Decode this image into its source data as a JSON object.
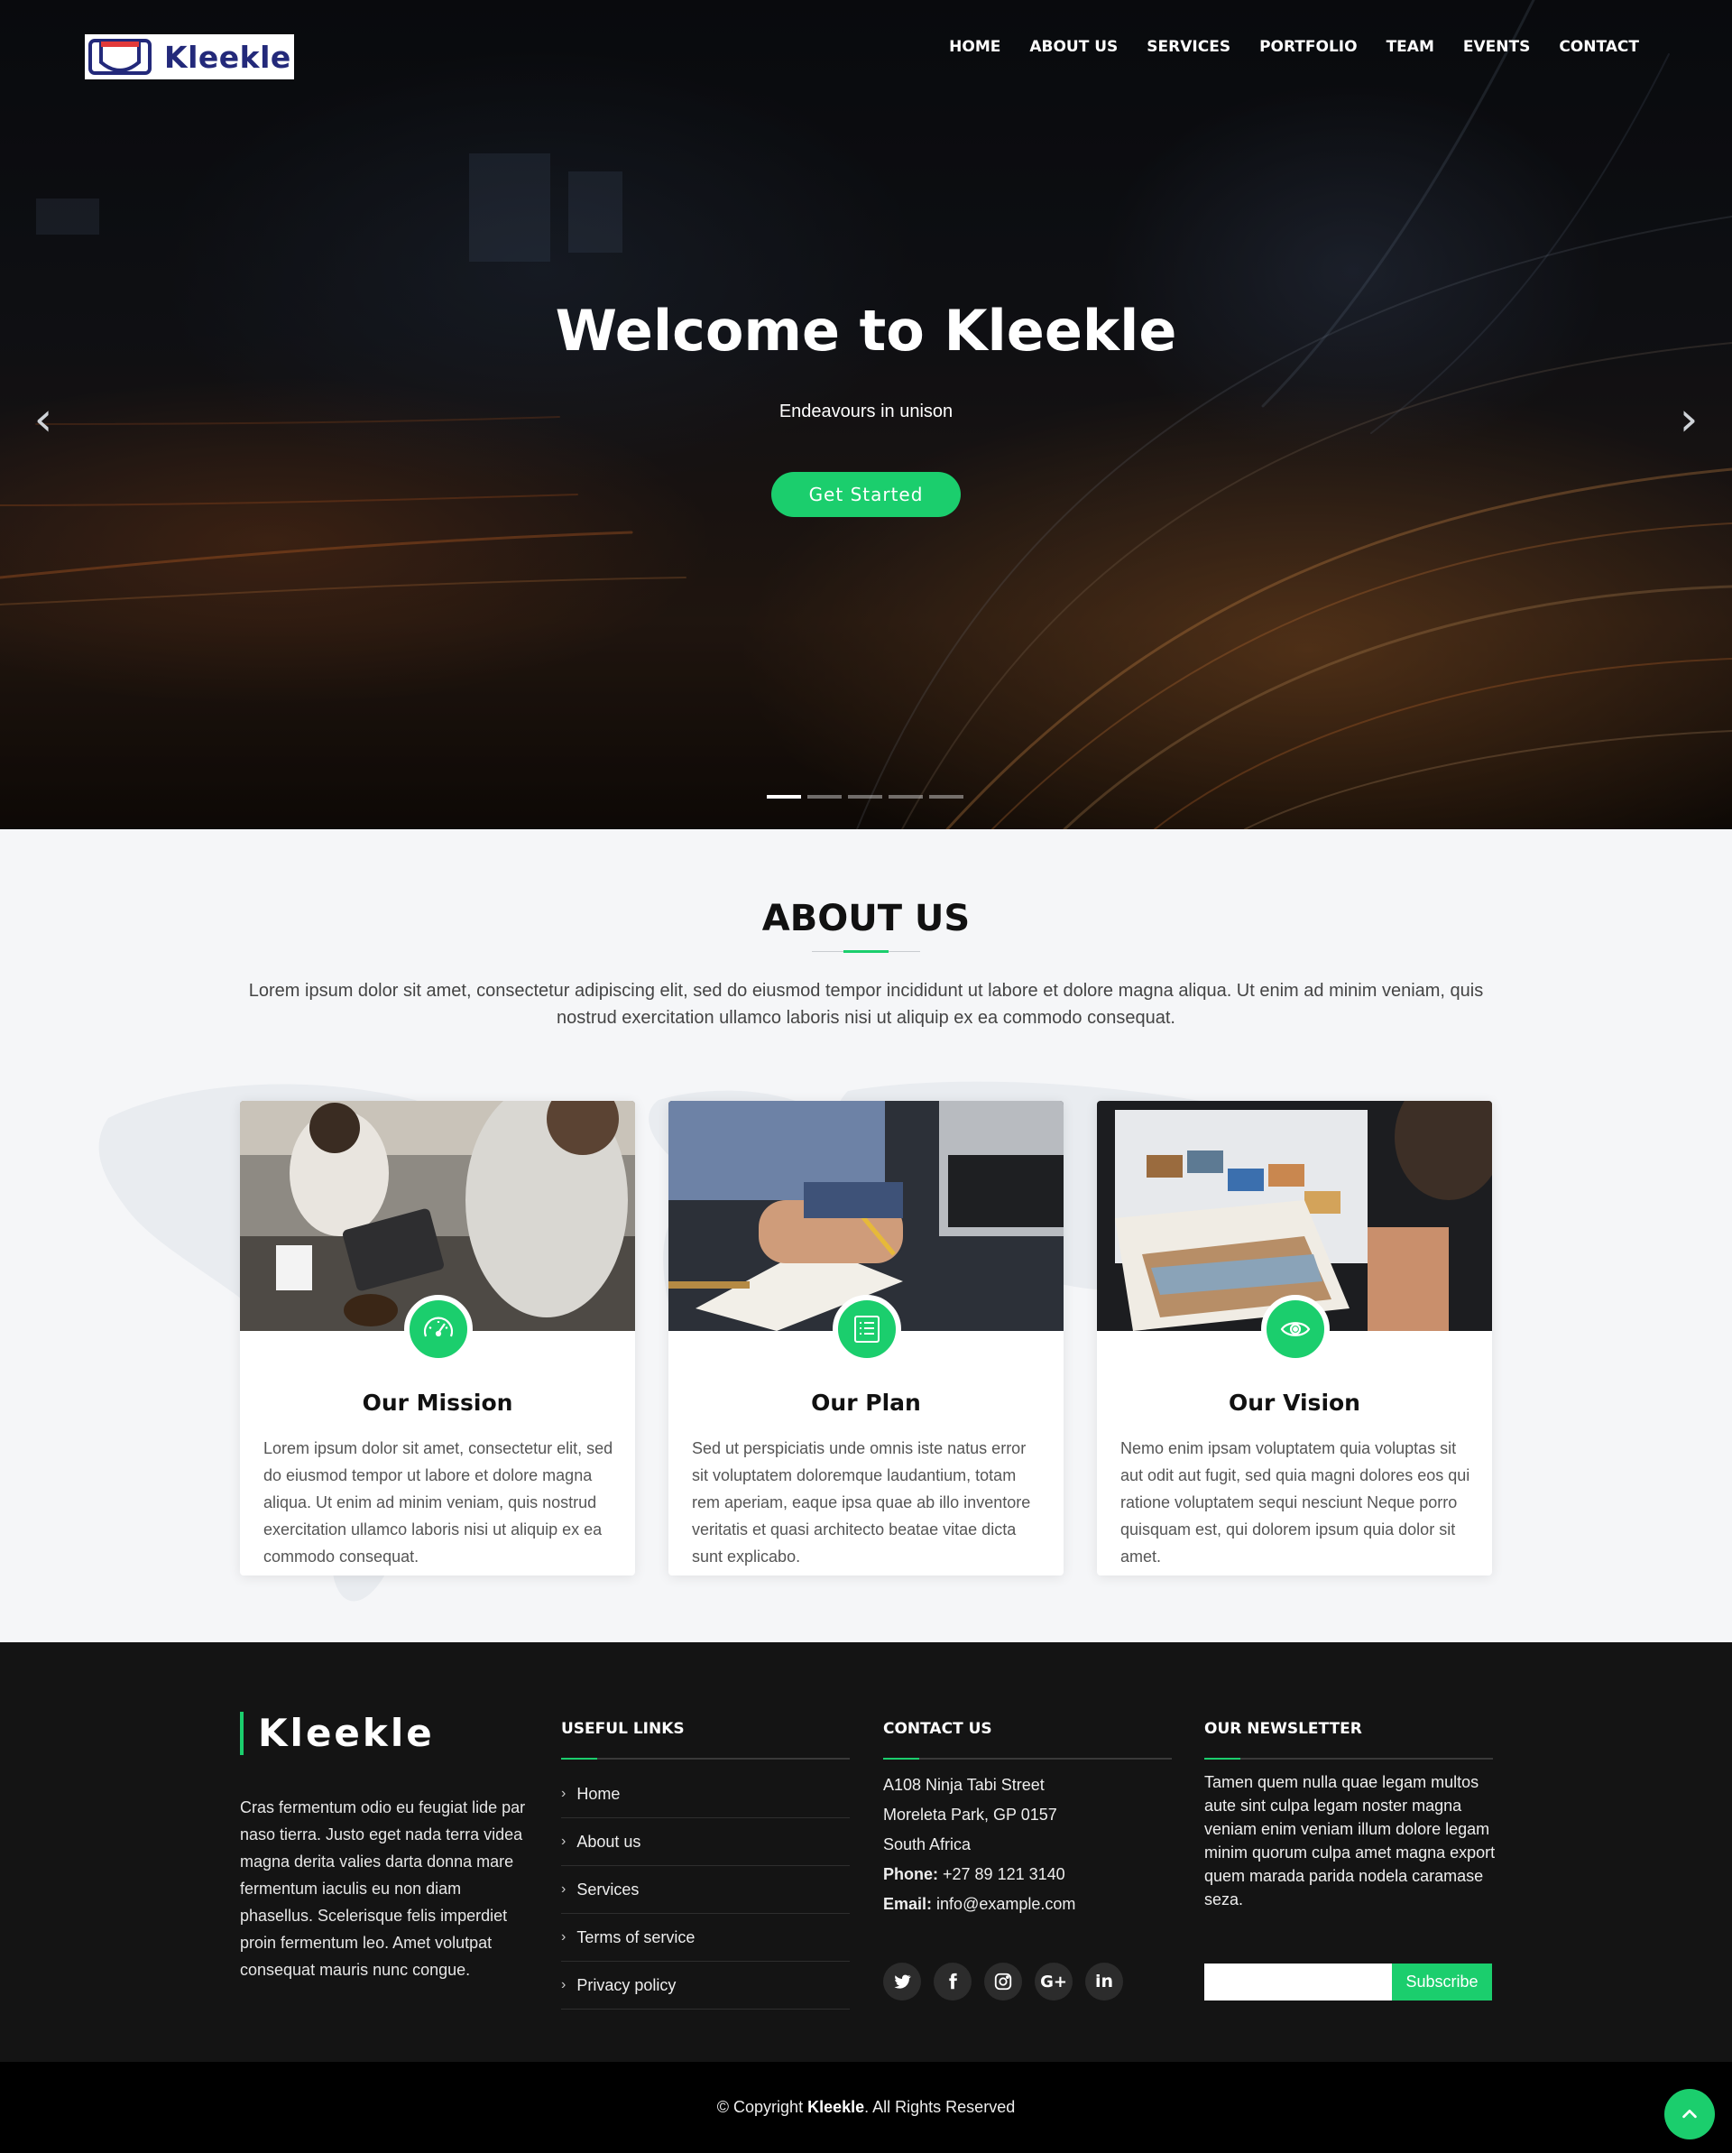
{
  "brand": {
    "name": "Kleekle"
  },
  "nav": {
    "items": [
      "HOME",
      "ABOUT US",
      "SERVICES",
      "PORTFOLIO",
      "TEAM",
      "EVENTS",
      "CONTACT"
    ]
  },
  "hero": {
    "title": "Welcome to Kleekle",
    "subtitle": "Endeavours in unison",
    "cta_label": "Get Started",
    "slide_count": 5,
    "active_slide": 1
  },
  "about": {
    "title": "ABOUT US",
    "intro": "Lorem ipsum dolor sit amet, consectetur adipiscing elit, sed do eiusmod tempor incididunt ut labore et dolore magna aliqua. Ut enim ad minim veniam, quis nostrud exercitation ullamco laboris nisi ut aliquip ex ea commodo consequat.",
    "cards": [
      {
        "title": "Our Mission",
        "icon": "speedometer-icon",
        "text": "Lorem ipsum dolor sit amet, consectetur elit, sed do eiusmod tempor ut labore et dolore magna aliqua. Ut enim ad minim veniam, quis nostrud exercitation ullamco laboris nisi ut aliquip ex ea commodo consequat."
      },
      {
        "title": "Our Plan",
        "icon": "list-icon",
        "text": "Sed ut perspiciatis unde omnis iste natus error sit voluptatem doloremque laudantium, totam rem aperiam, eaque ipsa quae ab illo inventore veritatis et quasi architecto beatae vitae dicta sunt explicabo."
      },
      {
        "title": "Our Vision",
        "icon": "eye-icon",
        "text": "Nemo enim ipsam voluptatem quia voluptas sit aut odit aut fugit, sed quia magni dolores eos qui ratione voluptatem sequi nesciunt Neque porro quisquam est, qui dolorem ipsum quia dolor sit amet."
      }
    ]
  },
  "footer": {
    "brand": "Kleekle",
    "about_text": "Cras fermentum odio eu feugiat lide par naso tierra. Justo eget nada terra videa magna derita valies darta donna mare fermentum iaculis eu non diam phasellus. Scelerisque felis imperdiet proin fermentum leo. Amet volutpat consequat mauris nunc congue.",
    "useful_links": {
      "title": "USEFUL LINKS",
      "items": [
        "Home",
        "About us",
        "Services",
        "Terms of service",
        "Privacy policy"
      ]
    },
    "contact": {
      "title": "CONTACT US",
      "address_line1": "A108 Ninja Tabi Street",
      "address_line2": "Moreleta Park, GP 0157",
      "address_line3": "South Africa",
      "phone_label": "Phone:",
      "phone": "+27 89 121 3140",
      "email_label": "Email:",
      "email": "info@example.com",
      "socials": [
        "twitter-icon",
        "facebook-icon",
        "instagram-icon",
        "google-plus-icon",
        "linkedin-icon"
      ]
    },
    "newsletter": {
      "title": "OUR NEWSLETTER",
      "text": "Tamen quem nulla quae legam multos aute sint culpa legam noster magna veniam enim veniam illum dolore legam minim quorum culpa amet magna export quem marada parida nodela caramase seza.",
      "input_value": "",
      "button_label": "Subscribe"
    },
    "copyright_prefix": "© Copyright",
    "copyright_brand": "Kleekle",
    "copyright_suffix": ". All Rights Reserved"
  },
  "colors": {
    "accent": "#1bce6d",
    "footer_bg": "#141414",
    "brand_navy": "#23297a"
  }
}
